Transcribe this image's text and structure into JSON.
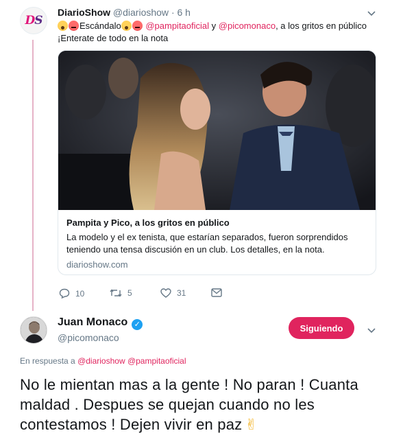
{
  "tweet1": {
    "display_name": "DiarioShow",
    "handle": "@diarioshow",
    "separator": "·",
    "time": "6 h",
    "text_word": "Escándalo",
    "mention1": "@pampitaoficial",
    "connector": " y ",
    "mention2": "@picomonaco",
    "text_rest": ", a los gritos en público",
    "line2": "¡Enterate de todo en la nota",
    "avatar_logo": "DS",
    "card": {
      "title": "Pampita y Pico, a los gritos en público",
      "description": "La modelo y el ex tenista, que estarían separados, fueron sorprendidos teniendo una tensa discusión en un club. Los detalles, en la nota.",
      "domain": "diarioshow.com"
    },
    "actions": {
      "replies": "10",
      "retweets": "5",
      "likes": "31"
    }
  },
  "tweet2": {
    "display_name": "Juan Monaco",
    "handle": "@picomonaco",
    "follow_label": "Siguiendo",
    "reply_prefix": "En respuesta a",
    "reply_mention1": "@diarioshow",
    "reply_mention2": "@pampitaoficial",
    "text": "No le mientan mas a la gente ! No paran ! Cuanta maldad . Despues se quejan cuando no les contestamos ! Dejen vivir en paz"
  },
  "colors": {
    "accent": "#e0245e",
    "muted": "#657786",
    "verified": "#1da1f2",
    "thread_line": "#e6b3c7"
  }
}
